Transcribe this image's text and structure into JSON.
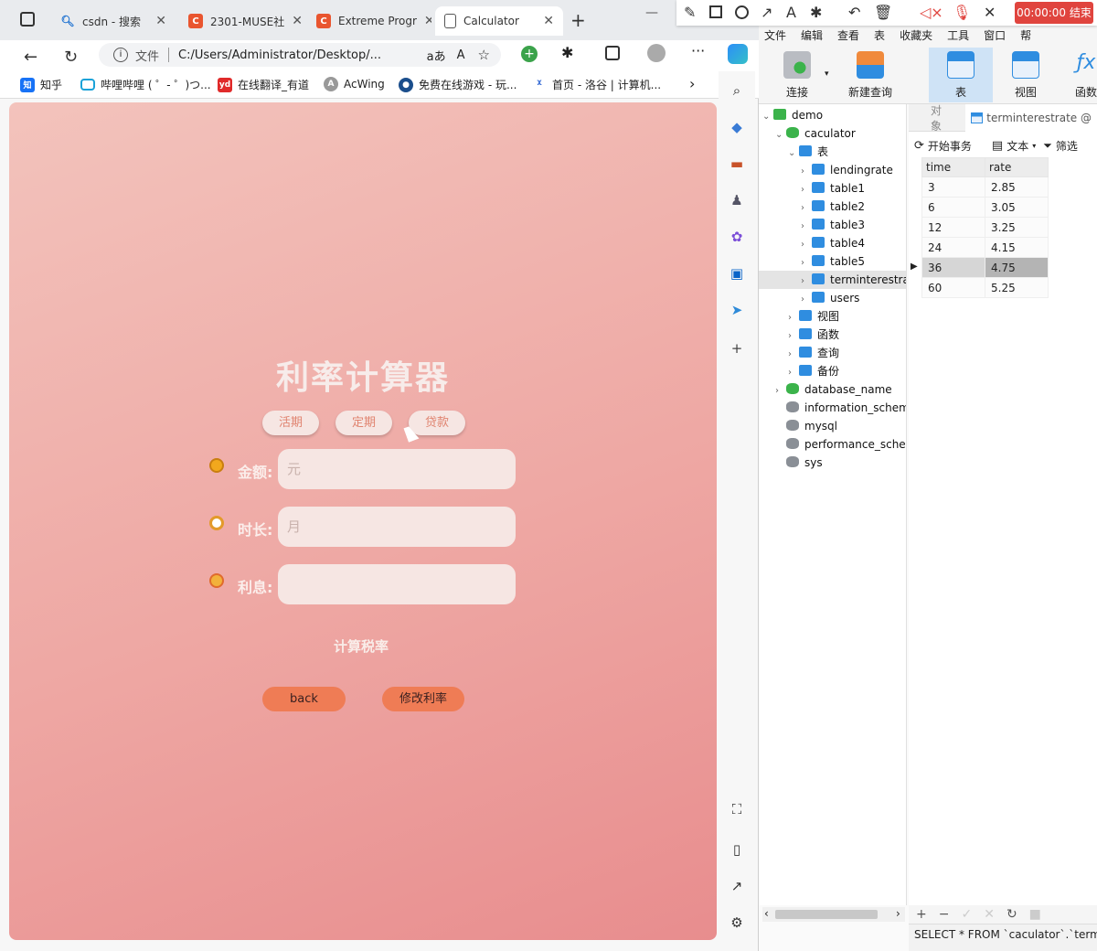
{
  "browser": {
    "tabs": [
      {
        "title": "csdn - 搜索"
      },
      {
        "title": "2301-MUSE社"
      },
      {
        "title": "Extreme Progr"
      },
      {
        "title": "Calculator"
      }
    ],
    "address": {
      "info_label": "文件",
      "url": "C:/Users/Administrator/Desktop/..."
    },
    "bookmarks": [
      "知乎",
      "哔哩哔哩 ( ゜- ゜)つ...",
      "在线翻译_有道",
      "AcWing",
      "免费在线游戏 - 玩...",
      "首页 - 洛谷 | 计算机..."
    ]
  },
  "calculator": {
    "title": "利率计算器",
    "modes": [
      "活期",
      "定期",
      "贷款"
    ],
    "fields": [
      {
        "label": "金额:",
        "placeholder": "元"
      },
      {
        "label": "时长:",
        "placeholder": "月"
      },
      {
        "label": "利息:",
        "placeholder": ""
      }
    ],
    "calc_button": "计算税率",
    "back_button": "back",
    "modify_button": "修改利率"
  },
  "recorder": {
    "stop_label": "00:00:00 结束"
  },
  "db_app": {
    "menu": [
      "文件",
      "编辑",
      "查看",
      "表",
      "收藏夹",
      "工具",
      "窗口",
      "帮"
    ],
    "toolbar": [
      "连接",
      "新建查询",
      "表",
      "视图",
      "函数"
    ],
    "tree": [
      {
        "label": "demo",
        "level": 0,
        "arrow": "⌄"
      },
      {
        "label": "caculator",
        "level": 1,
        "arrow": "⌄"
      },
      {
        "label": "表",
        "level": 2,
        "arrow": "⌄"
      },
      {
        "label": "lendingrate",
        "level": 3,
        "arrow": "›"
      },
      {
        "label": "table1",
        "level": 3,
        "arrow": "›"
      },
      {
        "label": "table2",
        "level": 3,
        "arrow": "›"
      },
      {
        "label": "table3",
        "level": 3,
        "arrow": "›"
      },
      {
        "label": "table4",
        "level": 3,
        "arrow": "›"
      },
      {
        "label": "table5",
        "level": 3,
        "arrow": "›"
      },
      {
        "label": "terminterestrate",
        "level": 3,
        "arrow": "›",
        "selected": true
      },
      {
        "label": "users",
        "level": 3,
        "arrow": "›"
      },
      {
        "label": "视图",
        "level": 2,
        "arrow": "›"
      },
      {
        "label": "函数",
        "level": 2,
        "arrow": "›"
      },
      {
        "label": "查询",
        "level": 2,
        "arrow": "›"
      },
      {
        "label": "备份",
        "level": 2,
        "arrow": "›"
      },
      {
        "label": "database_name",
        "level": 1,
        "arrow": "›"
      },
      {
        "label": "information_schema",
        "level": 1,
        "arrow": ""
      },
      {
        "label": "mysql",
        "level": 1,
        "arrow": ""
      },
      {
        "label": "performance_schema",
        "level": 1,
        "arrow": ""
      },
      {
        "label": "sys",
        "level": 1,
        "arrow": ""
      }
    ],
    "object_tab": "对象",
    "table_tab": "terminterestrate @",
    "subtoolbar": {
      "begin": "开始事务",
      "text": "文本",
      "filter": "筛选"
    },
    "columns": [
      "time",
      "rate"
    ],
    "rows": [
      [
        "3",
        "2.85"
      ],
      [
        "6",
        "3.05"
      ],
      [
        "12",
        "3.25"
      ],
      [
        "24",
        "4.15"
      ],
      [
        "36",
        "4.75"
      ],
      [
        "60",
        "5.25"
      ]
    ],
    "status_sql": "SELECT * FROM `caculator`.`termin"
  }
}
